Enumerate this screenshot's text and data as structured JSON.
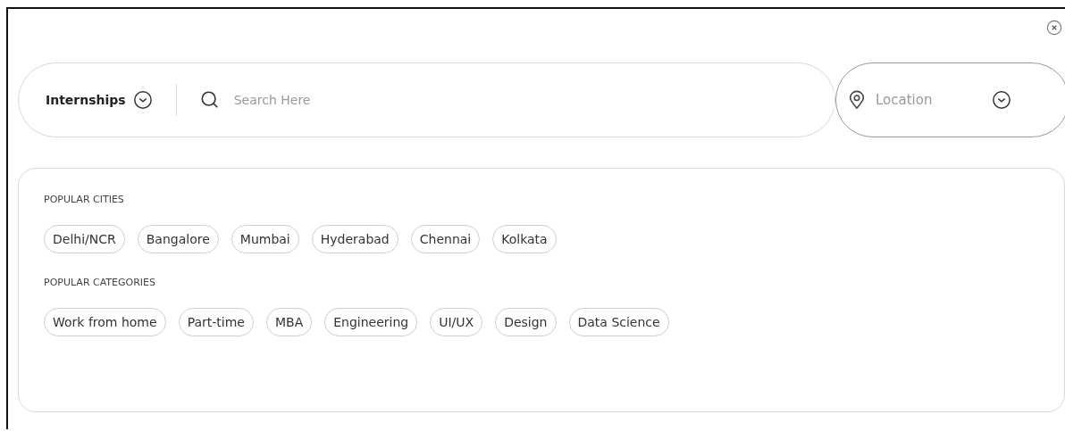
{
  "search_bar": {
    "category": "Internships",
    "placeholder": "Search Here"
  },
  "location": {
    "placeholder": "Location"
  },
  "sections": [
    {
      "title": "POPULAR CITIES",
      "chips": [
        "Delhi/NCR",
        "Bangalore",
        "Mumbai",
        "Hyderabad",
        "Chennai",
        "Kolkata"
      ]
    },
    {
      "title": "POPULAR CATEGORIES",
      "chips": [
        "Work from home",
        "Part-time",
        "MBA",
        "Engineering",
        "UI/UX",
        "Design",
        "Data Science"
      ]
    }
  ]
}
